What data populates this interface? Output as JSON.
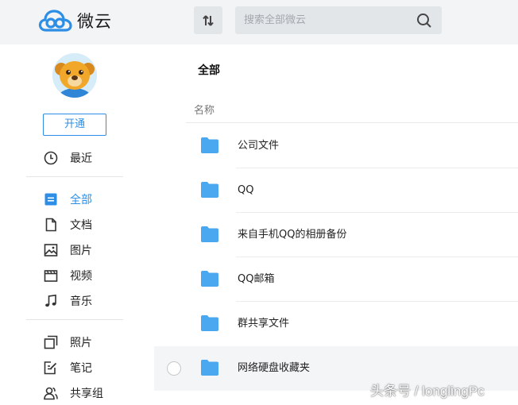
{
  "app": {
    "name": "微云",
    "accent": "#2c8fe5"
  },
  "toolbar": {
    "sort_icon": "sort-arrows-icon"
  },
  "search": {
    "placeholder": "搜索全部微云",
    "value": "",
    "icon": "search-icon"
  },
  "sidebar": {
    "open_button": "开通",
    "recent": {
      "label": "最近",
      "icon": "clock-icon"
    },
    "group1": [
      {
        "label": "全部",
        "icon": "all-files-icon",
        "active": true
      },
      {
        "label": "文档",
        "icon": "document-icon"
      },
      {
        "label": "图片",
        "icon": "image-icon"
      },
      {
        "label": "视频",
        "icon": "video-icon"
      },
      {
        "label": "音乐",
        "icon": "music-icon"
      }
    ],
    "group2": [
      {
        "label": "照片",
        "icon": "photo-icon"
      },
      {
        "label": "笔记",
        "icon": "note-icon"
      },
      {
        "label": "共享组",
        "icon": "share-group-icon"
      }
    ]
  },
  "main": {
    "breadcrumb": "全部",
    "column_name": "名称",
    "files": [
      {
        "name": "公司文件",
        "type": "folder"
      },
      {
        "name": "QQ",
        "type": "folder"
      },
      {
        "name": "来自手机QQ的相册备份",
        "type": "folder"
      },
      {
        "name": "QQ邮箱",
        "type": "folder"
      },
      {
        "name": "群共享文件",
        "type": "folder"
      },
      {
        "name": "网络硬盘收藏夹",
        "type": "folder",
        "hovered": true
      }
    ],
    "folder_color": "#4aa8f0"
  },
  "watermark": "头条号 / longlingPc"
}
